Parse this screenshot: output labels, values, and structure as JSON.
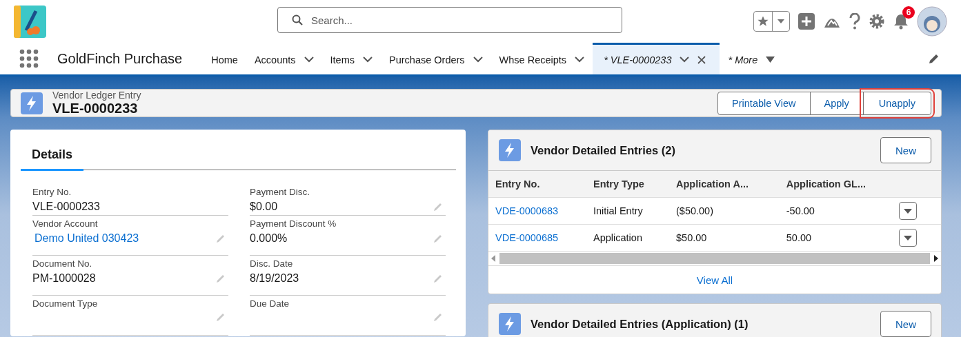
{
  "header": {
    "search": {
      "placeholder": "Search..."
    },
    "notification_count": "6"
  },
  "nav": {
    "app_name": "GoldFinch Purchase",
    "tabs": [
      {
        "label": "Home",
        "kind": "link",
        "selected": false
      },
      {
        "label": "Accounts",
        "kind": "menu",
        "selected": false
      },
      {
        "label": "Items",
        "kind": "menu",
        "selected": false
      },
      {
        "label": "Purchase Orders",
        "kind": "menu",
        "selected": false
      },
      {
        "label": "Whse Receipts",
        "kind": "menu",
        "selected": false
      },
      {
        "label": "* VLE-0000233",
        "kind": "record",
        "selected": true
      },
      {
        "label": "* More",
        "kind": "overflow",
        "selected": false
      }
    ]
  },
  "record": {
    "object_type": "Vendor Ledger Entry",
    "title": "VLE-0000233",
    "actions": [
      {
        "label": "Printable View",
        "highlighted": false
      },
      {
        "label": "Apply",
        "highlighted": false
      },
      {
        "label": "Unapply",
        "highlighted": true
      }
    ]
  },
  "details": {
    "tab": "Details",
    "columns": [
      [
        {
          "label": "Entry No.",
          "value": "VLE-0000233",
          "kind": "text",
          "editable": false
        },
        {
          "label": "Vendor Account",
          "value": "Demo United 030423",
          "kind": "link",
          "editable": true
        },
        {
          "label": "Document No.",
          "value": "PM-1000028",
          "kind": "text",
          "editable": true
        },
        {
          "label": "Document Type",
          "editable": true
        }
      ],
      [
        {
          "label": "Payment Disc.",
          "value": "$0.00",
          "kind": "text",
          "editable": true
        },
        {
          "label": "Payment Discount %",
          "value": "0.000%",
          "kind": "text",
          "editable": true
        },
        {
          "label": "Disc. Date",
          "value": "8/19/2023",
          "kind": "text",
          "editable": true
        },
        {
          "label": "Due Date",
          "editable": true
        }
      ]
    ]
  },
  "related": [
    {
      "title": "Vendor Detailed Entries (2)",
      "button": "New",
      "columns": [
        "Entry No.",
        "Entry Type",
        "Application A...",
        "Application GL..."
      ],
      "rows": [
        [
          "VDE-0000683",
          "Initial Entry",
          "($50.00)",
          "-50.00"
        ],
        [
          "VDE-0000685",
          "Application",
          "$50.00",
          "50.00"
        ]
      ],
      "footer": "View All"
    },
    {
      "title": "Vendor Detailed Entries (Application) (1)",
      "button": "New"
    }
  ]
}
